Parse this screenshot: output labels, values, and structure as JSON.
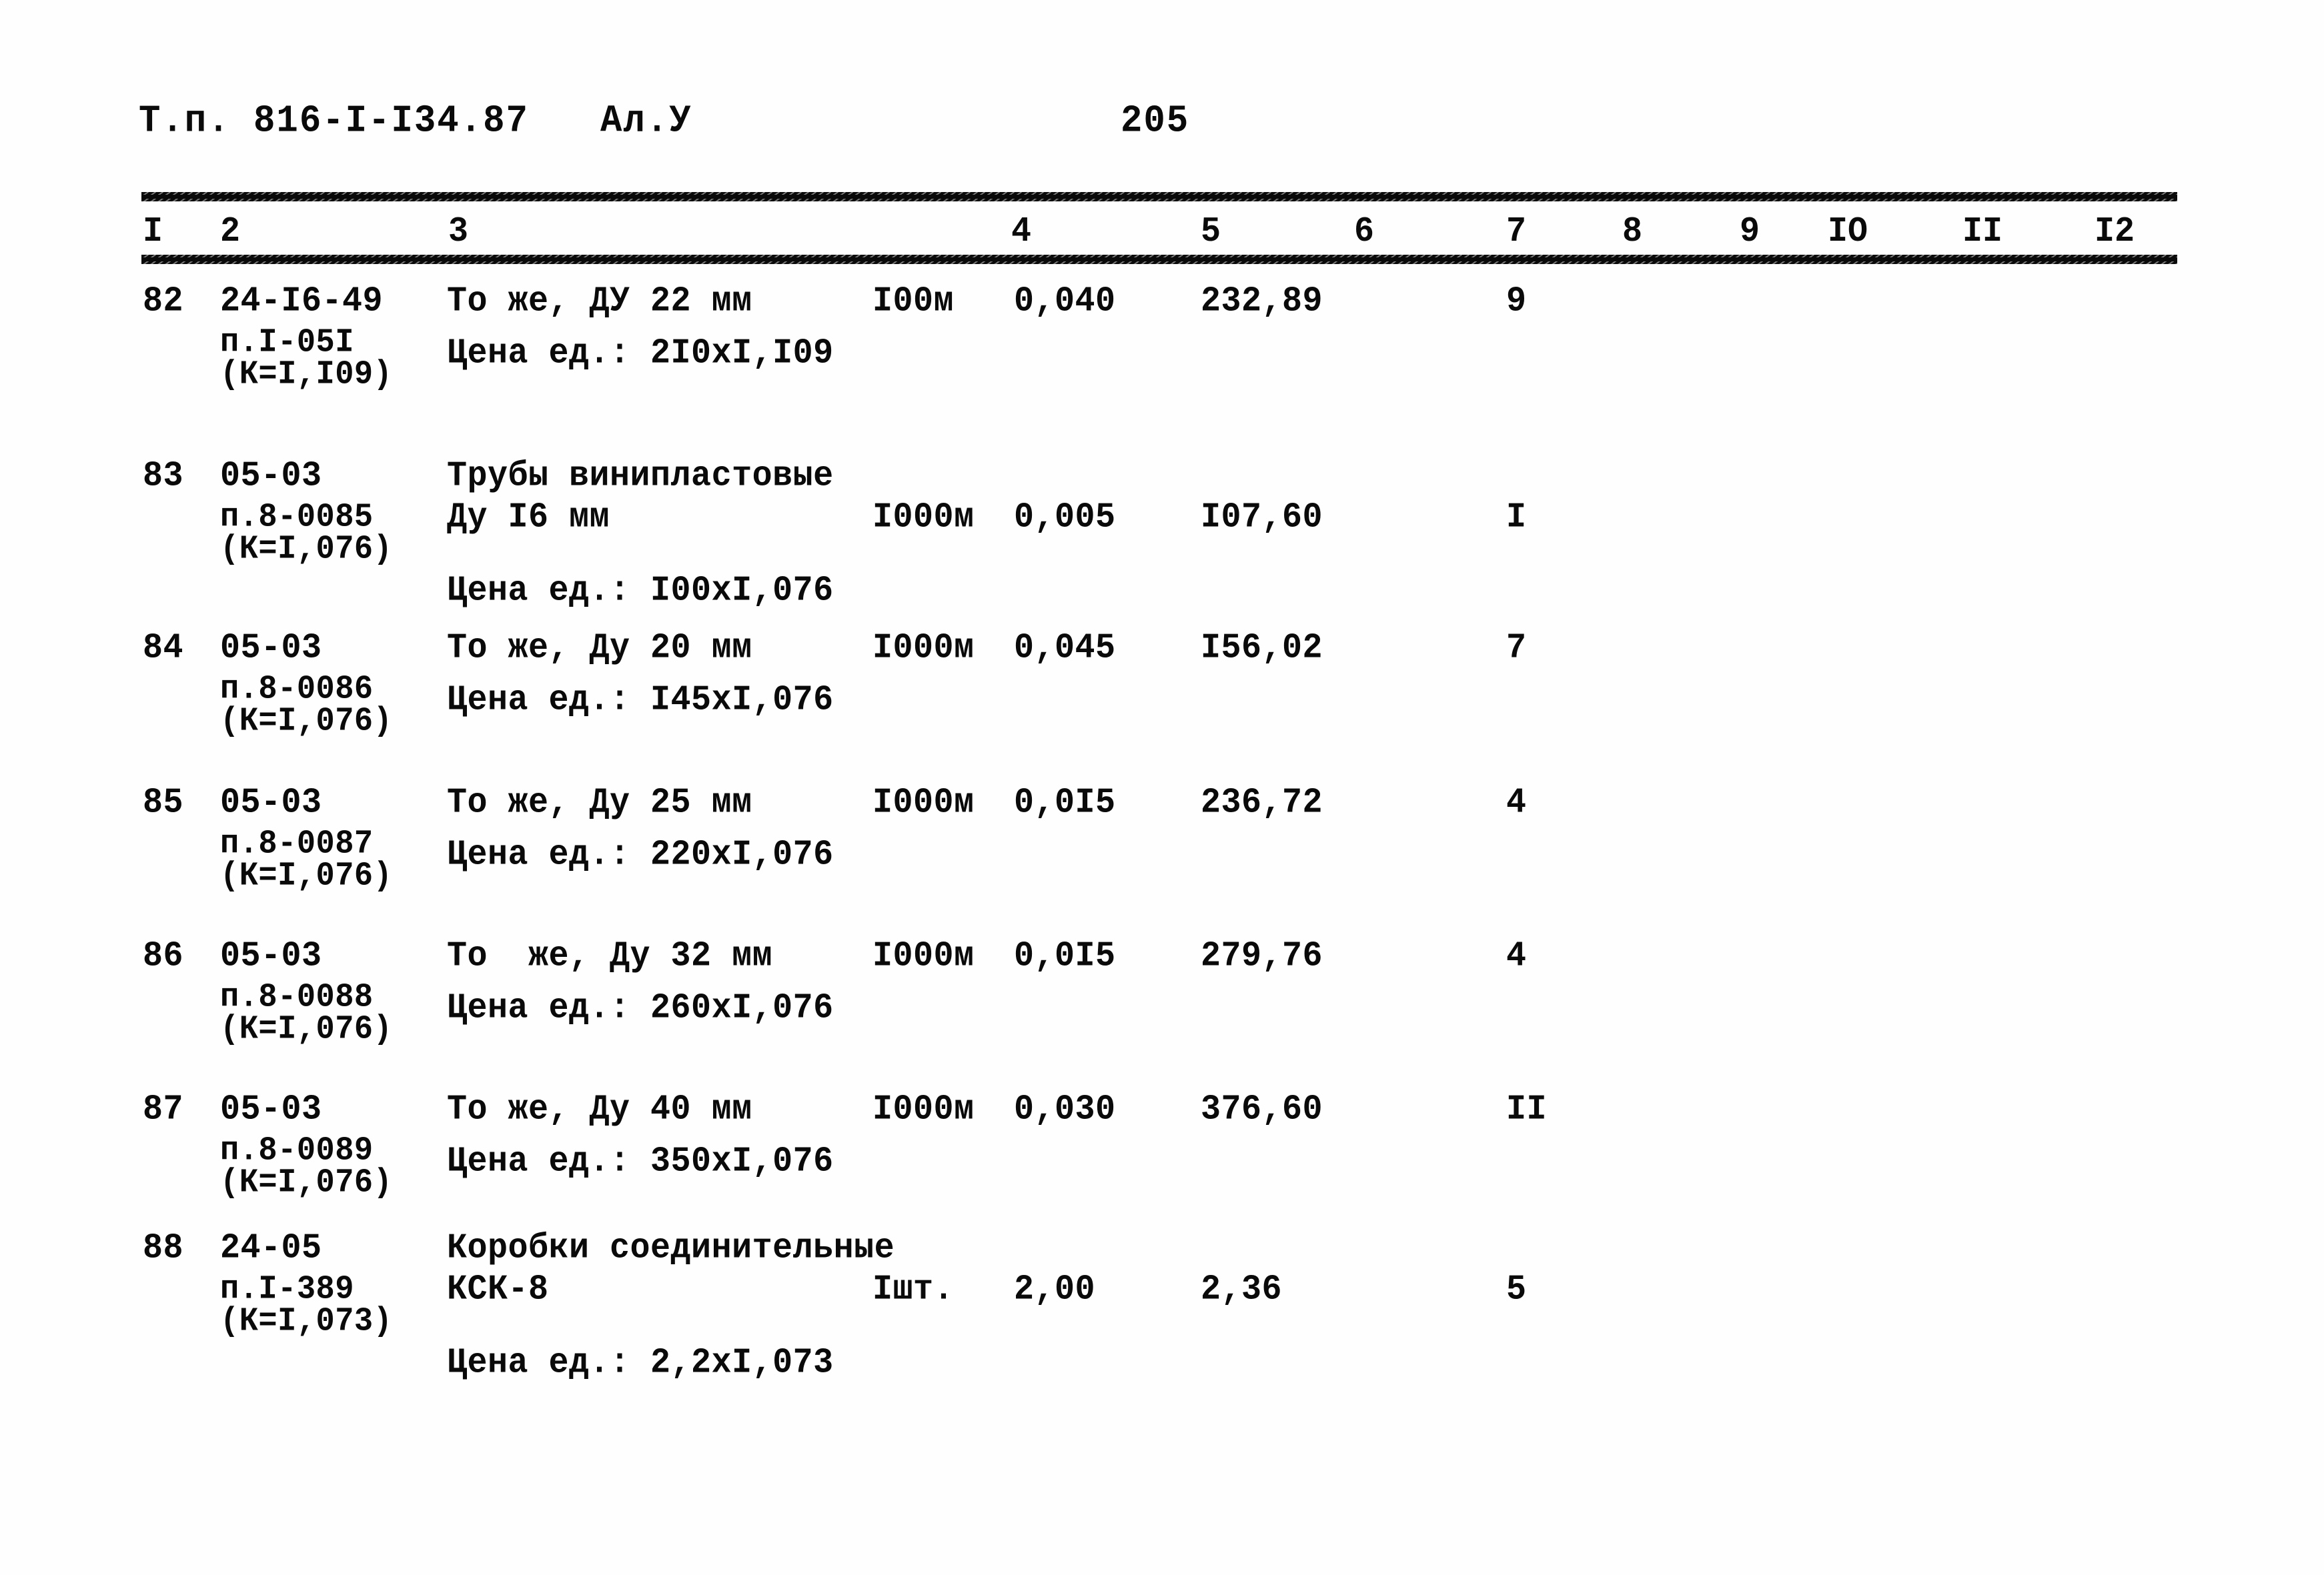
{
  "header": {
    "doc_code": "Т.п. 816-I-I34.87",
    "album": "Ал.У",
    "page_number": "205"
  },
  "table": {
    "column_numbers": [
      "I",
      "2",
      "3",
      "4",
      "5",
      "6",
      "7",
      "8",
      "9",
      "IO",
      "II",
      "I2"
    ],
    "rows": [
      {
        "num": "82",
        "code_line1": "24-I6-49",
        "code_line2": "п.I-05I",
        "code_line3": "(К=I,I09)",
        "name_line1": "То же, ДУ 22 мм",
        "name_line2": "",
        "price_note": "Цена ед.: 2I0xI,I09",
        "unit": "I00м",
        "qty": "0,040",
        "cost": "232,89",
        "col7": "9"
      },
      {
        "num": "83",
        "code_line1": "05-03",
        "code_line2": "п.8-0085",
        "code_line3": "(К=I,076)",
        "name_line1": "Трубы винипластовые",
        "name_line2": "Ду I6 мм",
        "price_note": "Цена ед.: I00xI,076",
        "unit": "I000м",
        "qty": "0,005",
        "cost": "I07,60",
        "col7": "I"
      },
      {
        "num": "84",
        "code_line1": "05-03",
        "code_line2": "п.8-0086",
        "code_line3": "(К=I,076)",
        "name_line1": "То же, Ду 20 мм",
        "name_line2": "",
        "price_note": "Цена ед.: I45xI,076",
        "unit": "I000м",
        "qty": "0,045",
        "cost": "I56,02",
        "col7": "7"
      },
      {
        "num": "85",
        "code_line1": "05-03",
        "code_line2": "п.8-0087",
        "code_line3": "(К=I,076)",
        "name_line1": "То же, Ду 25 мм",
        "name_line2": "",
        "price_note": "Цена ед.: 220xI,076",
        "unit": "I000м",
        "qty": "0,0I5",
        "cost": "236,72",
        "col7": "4"
      },
      {
        "num": "86",
        "code_line1": "05-03",
        "code_line2": "п.8-0088",
        "code_line3": "(К=I,076)",
        "name_line1": "То  же, Ду 32 мм",
        "name_line2": "",
        "price_note": "Цена ед.: 260xI,076",
        "unit": "I000м",
        "qty": "0,0I5",
        "cost": "279,76",
        "col7": "4"
      },
      {
        "num": "87",
        "code_line1": "05-03",
        "code_line2": "п.8-0089",
        "code_line3": "(К=I,076)",
        "name_line1": "То же, Ду 40 мм",
        "name_line2": "",
        "price_note": "Цена ед.: 350xI,076",
        "unit": "I000м",
        "qty": "0,030",
        "cost": "376,60",
        "col7": "II"
      },
      {
        "num": "88",
        "code_line1": "24-05",
        "code_line2": "п.I-389",
        "code_line3": "(К=I,073)",
        "name_line1": "Коробки соединительные",
        "name_line2": "КСК-8",
        "price_note": "Цена ед.: 2,2xI,073",
        "unit": "Iшт.",
        "qty": "2,00",
        "cost": "2,36",
        "col7": "5"
      }
    ]
  }
}
